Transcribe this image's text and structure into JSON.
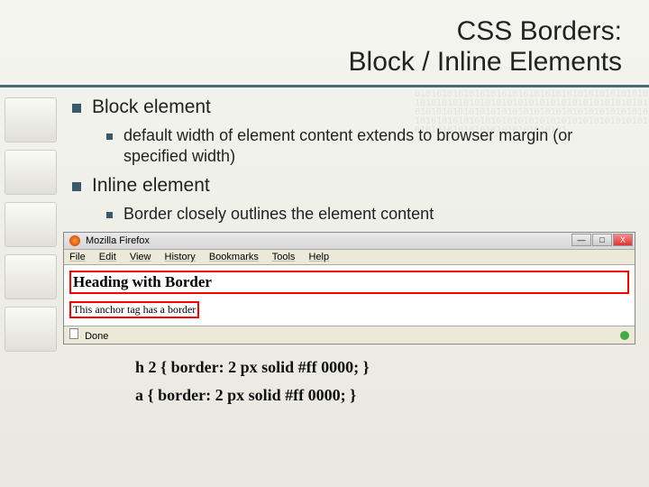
{
  "title": {
    "line1": "CSS Borders:",
    "line2": "Block / Inline Elements"
  },
  "bullets": {
    "block": {
      "label": "Block element",
      "sub": "default width of element content extends to browser margin (or specified width)"
    },
    "inline": {
      "label": "Inline element",
      "sub": "Border closely outlines the element content"
    }
  },
  "browser": {
    "app_name": "Mozilla Firefox",
    "menu": [
      "File",
      "Edit",
      "View",
      "History",
      "Bookmarks",
      "Tools",
      "Help"
    ],
    "heading_text": "Heading with Border",
    "anchor_text": "This anchor tag has a border",
    "status_text": "Done",
    "win_buttons": {
      "min": "—",
      "max": "□",
      "close": "X"
    }
  },
  "code": {
    "line1": "h 2 { border: 2 px solid #ff 0000; }",
    "line2": "a   { border: 2 px solid #ff 0000; }"
  },
  "bg_pattern": "01010101010101010101010101010101010101010101010101010101010101010101010101010101010101010101010101010101010101010101010101010101010101010101010101010101010101010101010101010101010101010101010101010101"
}
